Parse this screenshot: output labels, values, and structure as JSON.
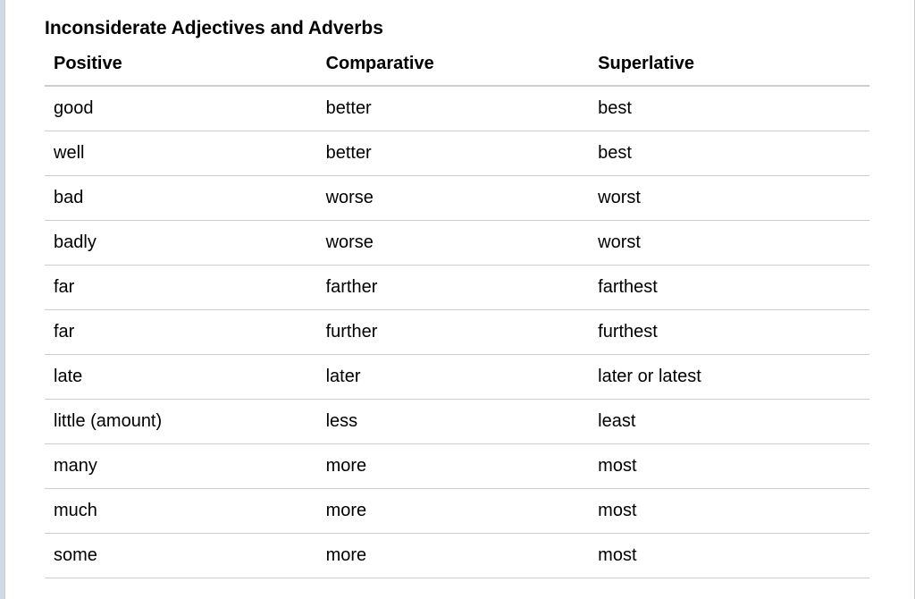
{
  "title": "Inconsiderate Adjectives and Adverbs",
  "headers": {
    "col1": "Positive",
    "col2": "Comparative",
    "col3": "Superlative"
  },
  "rows": [
    {
      "positive": "good",
      "comparative": "better",
      "superlative": "best"
    },
    {
      "positive": "well",
      "comparative": "better",
      "superlative": "best"
    },
    {
      "positive": "bad",
      "comparative": "worse",
      "superlative": "worst"
    },
    {
      "positive": "badly",
      "comparative": "worse",
      "superlative": "worst"
    },
    {
      "positive": "far",
      "comparative": "farther",
      "superlative": "farthest"
    },
    {
      "positive": "far",
      "comparative": "further",
      "superlative": "furthest"
    },
    {
      "positive": "late",
      "comparative": "later",
      "superlative": "later or latest"
    },
    {
      "positive": "little (amount)",
      "comparative": "less",
      "superlative": "least"
    },
    {
      "positive": "many",
      "comparative": "more",
      "superlative": "most"
    },
    {
      "positive": "much",
      "comparative": "more",
      "superlative": "most"
    },
    {
      "positive": "some",
      "comparative": "more",
      "superlative": "most"
    }
  ]
}
